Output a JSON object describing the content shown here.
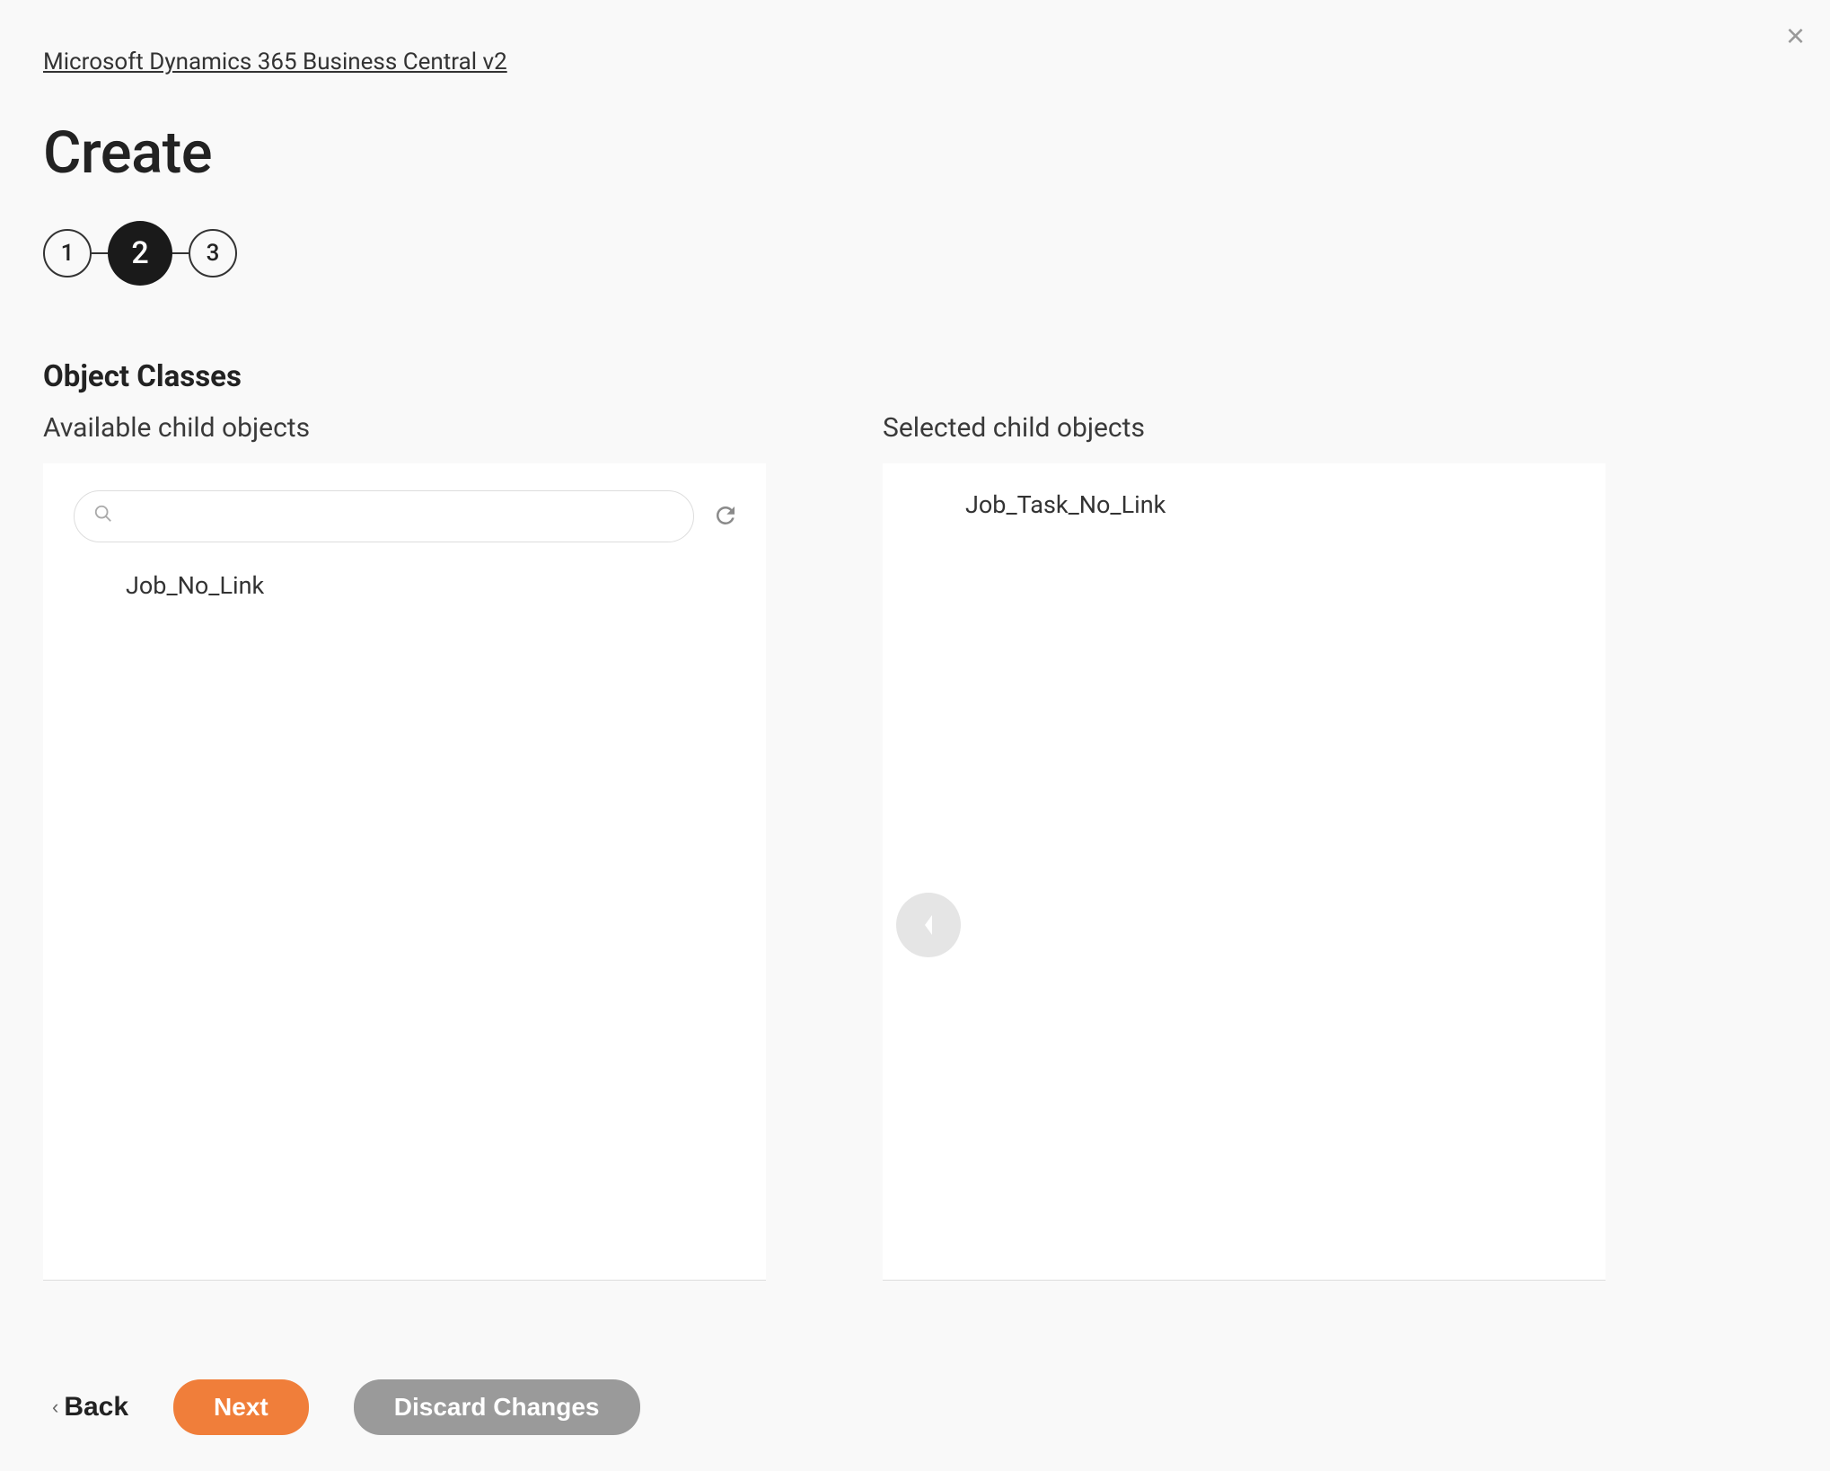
{
  "breadcrumb": "Microsoft Dynamics 365 Business Central v2",
  "page_title": "Create",
  "stepper": {
    "steps": [
      "1",
      "2",
      "3"
    ],
    "active_index": 1
  },
  "section_title": "Object Classes",
  "available": {
    "header": "Available child objects",
    "search_value": "",
    "items": [
      "Job_No_Link"
    ]
  },
  "selected": {
    "header": "Selected child objects",
    "items": [
      "Job_Task_No_Link"
    ]
  },
  "footer": {
    "back": "Back",
    "next": "Next",
    "discard": "Discard Changes"
  }
}
